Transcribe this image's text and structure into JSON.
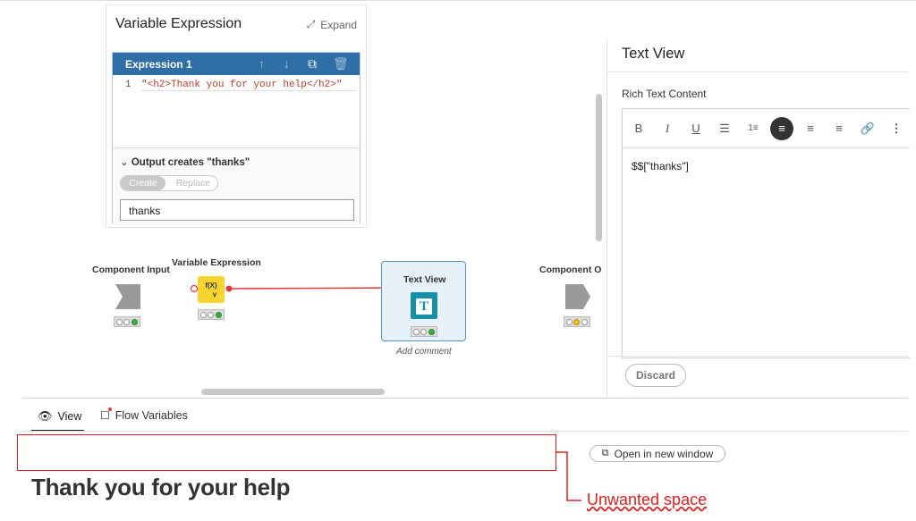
{
  "variable_expression_panel": {
    "title": "Variable Expression",
    "expand_label": "Expand",
    "expression": {
      "header": "Expression 1",
      "line_number": "1",
      "code": "\"<h2>Thank you for your help</h2>\""
    },
    "output": {
      "label": "Output creates \"thanks\"",
      "toggle": [
        "Create",
        "Replace"
      ],
      "selected": "Create",
      "variable_name": "thanks"
    }
  },
  "canvas": {
    "nodes": {
      "component_input": "Component Input",
      "variable_expression": "Variable Expression",
      "variable_expression_icon": "f(X)\nv",
      "text_view": "Text View",
      "text_view_icon": "T",
      "component_output": "Component O"
    },
    "add_comment": "Add comment"
  },
  "text_view_panel": {
    "title": "Text View",
    "rich_text_label": "Rich Text Content",
    "toolbar": [
      "B",
      "I",
      "U",
      "bullet-list",
      "numbered-list",
      "align-left",
      "align-center",
      "align-right",
      "link",
      "more"
    ],
    "editor_content": "$$[\"thanks\"]",
    "discard_label": "Discard"
  },
  "bottom": {
    "tabs": [
      {
        "label": "View",
        "active": true
      },
      {
        "label": "Flow Variables",
        "active": false
      }
    ],
    "open_new_window": "Open in new window",
    "heading": "Thank you for your help"
  },
  "annotation": {
    "label": "Unwanted space",
    "color": "#e02020"
  },
  "colors": {
    "expression_header": "#2f6ea6",
    "text_view_node_icon": "#1690a8",
    "variable_expression_node_icon": "#f8d430",
    "connection": "#e03a3a"
  }
}
